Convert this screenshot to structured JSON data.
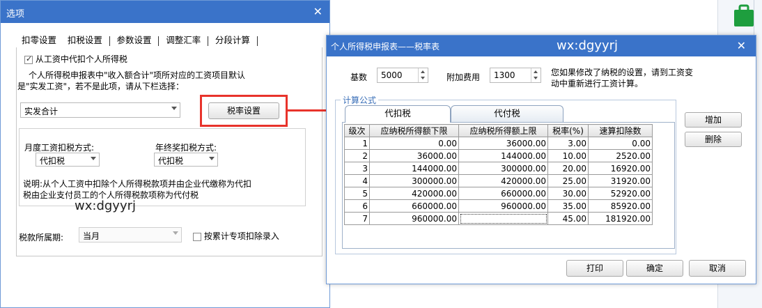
{
  "left_dialog": {
    "title": "选项",
    "close_glyph": "✕",
    "tabs": [
      "扣零设置",
      "扣税设置",
      "参数设置",
      "调整汇率",
      "分段计算"
    ],
    "deduct_checkbox_label": "从工资中代扣个人所得税",
    "note_line1": "个人所得税申报表中\"收入额合计\"项所对应的工资项目默认",
    "note_line2": "是\"实发工资\"，若不是此项，请从下栏选择：",
    "income_item_value": "实发合计",
    "rate_button_label": "税率设置",
    "monthly_method_label": "月度工资扣税方式:",
    "monthly_method_value": "代扣税",
    "annual_method_label": "年终奖扣税方式:",
    "annual_method_value": "代扣税",
    "explain_line1": "说明:从个人工资中扣除个人所得税款项并由企业代缴称为代扣",
    "explain_line2": "税由企业支付员工的个人所得税款项称为代付税",
    "watermark": "wx:dgyyrj",
    "period_label": "税款所属期:",
    "period_value": "当月",
    "cumulative_label": "按累计专项扣除录入"
  },
  "right_dialog": {
    "title": "个人所得税申报表——税率表",
    "watermark": "wx:dgyyrj",
    "close_glyph": "✕",
    "base_label": "基数",
    "base_value": "5000",
    "extra_label": "附加费用",
    "extra_value": "1300",
    "hint_line1": "您如果修改了纳税的设置，请到工资变",
    "hint_line2": "动中重新进行工资计算。",
    "formula_group_label": "计算公式",
    "tabs": [
      "代扣税",
      "代付税"
    ],
    "table_headers": [
      "级次",
      "应纳税所得额下限",
      "应纳税所得额上限",
      "税率(%)",
      "速算扣除数"
    ],
    "rows": [
      [
        "1",
        "0.00",
        "36000.00",
        "3.00",
        "0.00"
      ],
      [
        "2",
        "36000.00",
        "144000.00",
        "10.00",
        "2520.00"
      ],
      [
        "3",
        "144000.00",
        "300000.00",
        "20.00",
        "16920.00"
      ],
      [
        "4",
        "300000.00",
        "420000.00",
        "25.00",
        "31920.00"
      ],
      [
        "5",
        "420000.00",
        "660000.00",
        "30.00",
        "52920.00"
      ],
      [
        "6",
        "660000.00",
        "960000.00",
        "35.00",
        "85920.00"
      ],
      [
        "7",
        "960000.00",
        "",
        "45.00",
        "181920.00"
      ]
    ],
    "add_button": "增加",
    "delete_button": "删除",
    "print_button": "打印",
    "ok_button": "确定",
    "cancel_button": "取消"
  },
  "colors": {
    "titlebar": "#3a73c9",
    "highlight_red": "#e8332b",
    "app_icon_green": "#1e9e3e"
  },
  "icons": [
    "briefcase-icon",
    "close-icon",
    "checkbox-icon",
    "dropdown-arrow-icon",
    "spinner-arrows-icon"
  ]
}
